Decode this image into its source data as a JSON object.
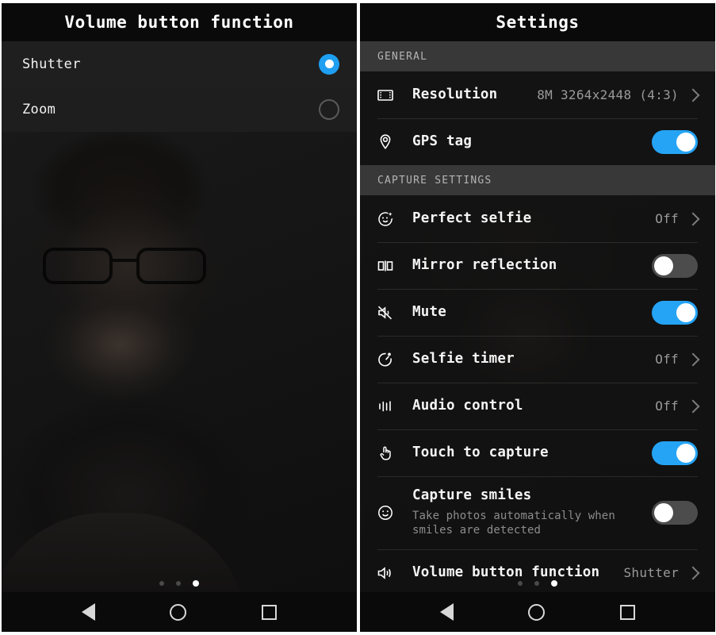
{
  "left_panel": {
    "title": "Volume button function",
    "options": [
      {
        "label": "Shutter",
        "selected": true,
        "icon": "radio-selected-icon"
      },
      {
        "label": "Zoom",
        "selected": false,
        "icon": "radio-unselected-icon"
      }
    ],
    "page_dots": {
      "count": 3,
      "active_index": 2
    },
    "navbar": [
      {
        "name": "back-button",
        "icon": "back-triangle-icon"
      },
      {
        "name": "home-button",
        "icon": "home-circle-icon"
      },
      {
        "name": "recents-button",
        "icon": "recents-square-icon"
      }
    ]
  },
  "right_panel": {
    "title": "Settings",
    "sections": [
      {
        "header": "GENERAL",
        "rows": [
          {
            "icon": "film-frame-icon",
            "title": "Resolution",
            "value": "8M 3264x2448 (4:3)",
            "control": "chevron"
          },
          {
            "icon": "location-pin-icon",
            "title": "GPS tag",
            "value": "",
            "control": "toggle-on"
          }
        ]
      },
      {
        "header": "CAPTURE SETTINGS",
        "rows": [
          {
            "icon": "perfect-selfie-icon",
            "title": "Perfect selfie",
            "value": "Off",
            "control": "chevron"
          },
          {
            "icon": "mirror-reflection-icon",
            "title": "Mirror reflection",
            "value": "",
            "control": "toggle-off"
          },
          {
            "icon": "mute-speaker-icon",
            "title": "Mute",
            "value": "",
            "control": "toggle-on"
          },
          {
            "icon": "stopwatch-icon",
            "title": "Selfie timer",
            "value": "Off",
            "control": "chevron"
          },
          {
            "icon": "equalizer-bars-icon",
            "title": "Audio control",
            "value": "Off",
            "control": "chevron"
          },
          {
            "icon": "pointing-hand-icon",
            "title": "Touch to capture",
            "value": "",
            "control": "toggle-on"
          },
          {
            "icon": "smiley-face-icon",
            "title": "Capture smiles",
            "subtitle": "Take photos automatically when smiles are detected",
            "value": "",
            "control": "toggle-off"
          },
          {
            "icon": "speaker-volume-icon",
            "title": "Volume button function",
            "value": "Shutter",
            "control": "chevron"
          }
        ]
      }
    ],
    "page_dots": {
      "count": 3,
      "active_index": 2
    },
    "navbar": [
      {
        "name": "back-button",
        "icon": "back-triangle-icon"
      },
      {
        "name": "home-button",
        "icon": "home-circle-icon"
      },
      {
        "name": "recents-button",
        "icon": "recents-square-icon"
      }
    ]
  },
  "colors": {
    "accent_blue": "#25a4f5",
    "panel_bg": "#121212",
    "titlebar_bg": "#0a0a0a",
    "section_header_bg": "#383838",
    "toggle_off": "#4c4c4c"
  }
}
